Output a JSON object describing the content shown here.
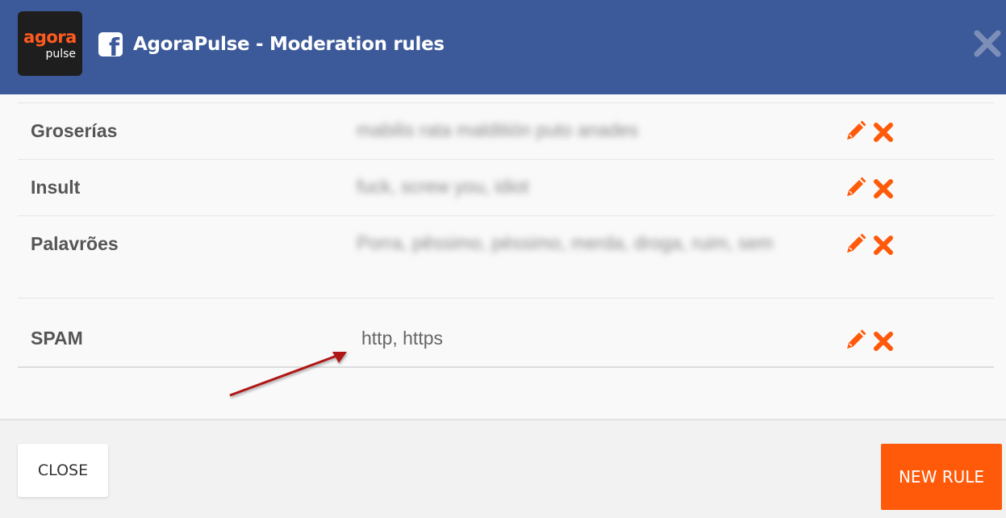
{
  "header": {
    "logo_line1": "agora",
    "logo_line2": "pulse",
    "title": "AgoraPulse - Moderation rules",
    "fb_icon": "facebook-icon",
    "close_icon": "close-icon"
  },
  "rules": [
    {
      "name": "Groserías",
      "words": "mabilis rata malditión puto anades",
      "words_blurred": true
    },
    {
      "name": "Insult",
      "words": "fuck, screw you, idiot",
      "words_blurred": true
    },
    {
      "name": "Palavrões",
      "words": "Porra, pêssimo, péssimo, merda, droga, ruim, sem",
      "words_blurred": true
    },
    {
      "name": "SPAM",
      "words": "http, https",
      "words_blurred": false
    }
  ],
  "icons": {
    "edit": "pencil-icon",
    "delete": "close-icon"
  },
  "footer": {
    "close_label": "CLOSE",
    "new_rule_label": "NEW RULE"
  },
  "colors": {
    "header_bg": "#3c5a99",
    "accent": "#ff5a0a",
    "annotation_arrow": "#b01818"
  }
}
